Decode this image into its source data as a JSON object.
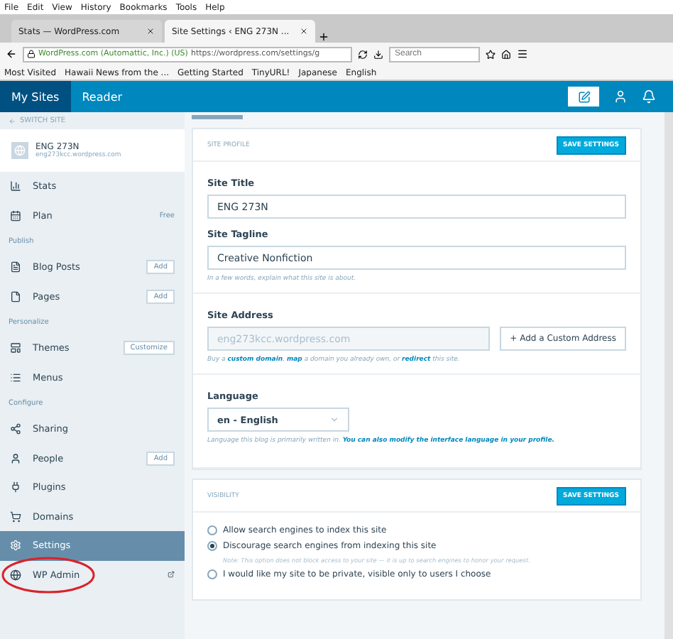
{
  "menu_bar": [
    "File",
    "Edit",
    "View",
    "History",
    "Bookmarks",
    "Tools",
    "Help"
  ],
  "tabs": [
    {
      "label": "Stats — WordPress.com",
      "selected": false
    },
    {
      "label": "Site Settings ‹ ENG 273N ...",
      "selected": true
    }
  ],
  "address_bar": {
    "identity": "WordPress.com (Automattic, Inc.) (US)",
    "url": "https://wordpress.com/settings/g"
  },
  "search": {
    "placeholder": "Search"
  },
  "bookmarks": [
    "Most Visited",
    "Hawaii News from the ...",
    "Getting Started",
    "TinyURL!",
    "Japanese",
    "English"
  ],
  "masthead": {
    "my_sites": "My Sites",
    "reader": "Reader"
  },
  "sidebar": {
    "switch_site": "SWITCH SITE",
    "site_name": "ENG 273N",
    "site_url": "eng273kcc.wordpress.com",
    "items": [
      {
        "kind": "item",
        "label": "Stats",
        "selected": false
      },
      {
        "kind": "item",
        "label": "Plan",
        "badge": "Free",
        "selected": false
      },
      {
        "kind": "heading",
        "label": "Publish"
      },
      {
        "kind": "item",
        "label": "Blog Posts",
        "action": "Add",
        "selected": false
      },
      {
        "kind": "item",
        "label": "Pages",
        "action": "Add",
        "selected": false
      },
      {
        "kind": "heading",
        "label": "Personalize"
      },
      {
        "kind": "item",
        "label": "Themes",
        "action": "Customize",
        "selected": false
      },
      {
        "kind": "item",
        "label": "Menus",
        "selected": false
      },
      {
        "kind": "heading",
        "label": "Configure"
      },
      {
        "kind": "item",
        "label": "Sharing",
        "selected": false
      },
      {
        "kind": "item",
        "label": "People",
        "action": "Add",
        "selected": false
      },
      {
        "kind": "item",
        "label": "Plugins",
        "selected": false
      },
      {
        "kind": "item",
        "label": "Domains",
        "selected": false
      },
      {
        "kind": "item",
        "label": "Settings",
        "selected": true
      },
      {
        "kind": "item",
        "label": "WP Admin",
        "external": true,
        "circled": true,
        "selected": false
      }
    ]
  },
  "site_profile": {
    "header": "SITE PROFILE",
    "save": "SAVE SETTINGS",
    "title_label": "Site Title",
    "title_value": "ENG 273N",
    "tagline_label": "Site Tagline",
    "tagline_value": "Creative Nonfiction",
    "tagline_hint": "In a few words, explain what this site is about.",
    "address_label": "Site Address",
    "address_value": "eng273kcc.wordpress.com",
    "custom_address": "+ Add a Custom Address",
    "address_hint": "Buy a **custom domain**, **map** a domain you already own, or **redirect** this site.",
    "language_label": "Language",
    "language_value": "en - English",
    "language_hint": "Language this blog is primarily written in. **You can also modify the interface language in your profile.**"
  },
  "visibility": {
    "header": "VISIBILITY",
    "save": "SAVE SETTINGS",
    "options": [
      {
        "label": "Allow search engines to index this site",
        "selected": false
      },
      {
        "label": "Discourage search engines from indexing this site",
        "selected": true,
        "note": "Note: This option does not block access to your site — it is up to search engines to honor your request."
      },
      {
        "label": "I would like my site to be private, visible only to users I choose",
        "selected": false
      }
    ]
  }
}
